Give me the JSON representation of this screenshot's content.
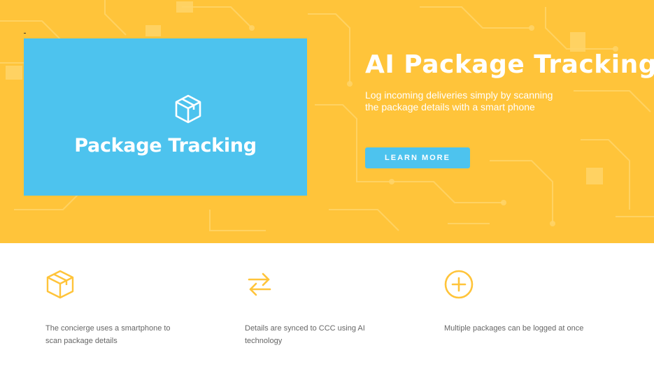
{
  "hero": {
    "banner_title": "Package Tracking",
    "banner_icon": "package-box-icon",
    "title": "AI Package Tracking",
    "description": "Log incoming deliveries simply by scanning the package details with a smart phone",
    "cta_label": "LEARN MORE",
    "colors": {
      "background": "#ffc43a",
      "accent": "#4dc3ee",
      "text": "#ffffff"
    }
  },
  "features": [
    {
      "icon": "package-box-icon",
      "text": "The concierge uses a smartphone to scan package details"
    },
    {
      "icon": "sync-arrows-icon",
      "text": "Details are synced to CCC using AI technology"
    },
    {
      "icon": "plus-circle-icon",
      "text": "Multiple packages can be logged at once"
    }
  ],
  "colors": {
    "feature_icon": "#ffc43a",
    "feature_text": "#666666"
  }
}
